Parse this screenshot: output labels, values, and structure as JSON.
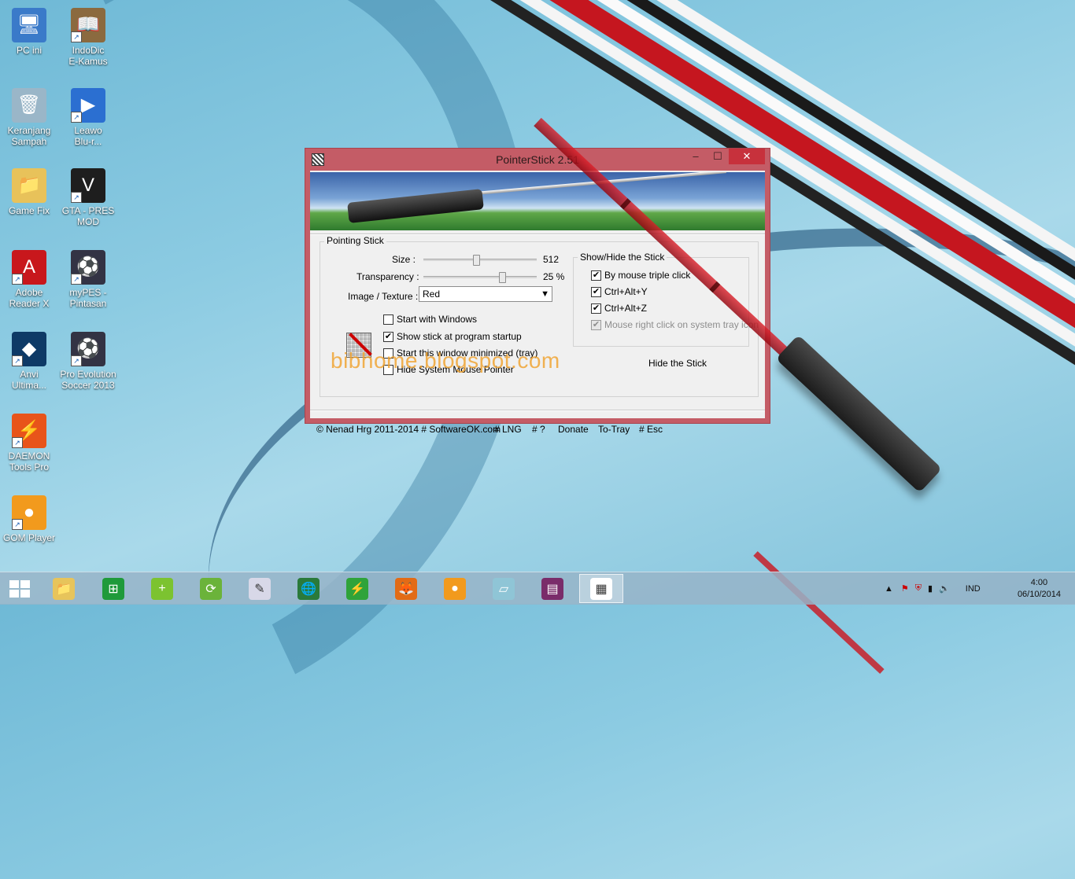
{
  "desktop": {
    "icons": [
      {
        "label": "PC ini",
        "icon": "computer-icon",
        "color": "#3a7ac9",
        "glyph": "🖥"
      },
      {
        "label": "IndoDic\nE-Kamus",
        "icon": "book-icon",
        "color": "#8b6a3f",
        "glyph": "📖"
      },
      {
        "label": "Keranjang\nSampah",
        "icon": "recycle-bin-icon",
        "color": "#9ab6c8",
        "glyph": "🗑"
      },
      {
        "label": "Leawo\nBlu-r...",
        "icon": "leawo-icon",
        "color": "#2b6fd1",
        "glyph": "▶"
      },
      {
        "label": "Game Fix",
        "icon": "folder-icon",
        "color": "#e8c25a",
        "glyph": "📁"
      },
      {
        "label": "GTA - PRES\nMOD",
        "icon": "gta-icon",
        "color": "#1e1e1e",
        "glyph": "V"
      },
      {
        "label": "Adobe\nReader X",
        "icon": "pdf-icon",
        "color": "#c8171c",
        "glyph": "A"
      },
      {
        "label": "myPES -\nPintasan",
        "icon": "pes-icon",
        "color": "#334",
        "glyph": "⚽"
      },
      {
        "label": "Anvi\nUltima...",
        "icon": "anvi-icon",
        "color": "#0e3a66",
        "glyph": "◆"
      },
      {
        "label": "Pro Evolution\nSoccer 2013",
        "icon": "pes2013-icon",
        "color": "#334",
        "glyph": "⚽"
      },
      {
        "label": "DAEMON\nTools Pro",
        "icon": "daemon-icon",
        "color": "#e8541a",
        "glyph": "⚡"
      },
      {
        "label": "GOM Player",
        "icon": "gom-icon",
        "color": "#f29a1d",
        "glyph": "●"
      }
    ]
  },
  "window": {
    "title": "PointerStick 2.51",
    "minimize": "‒",
    "maximize": "☐",
    "close": "✕",
    "pointing_group": "Pointing Stick",
    "size_label": "Size :",
    "size_value": "512",
    "size_fraction": 0.46,
    "transparency_label": "Transparency :",
    "transparency_value": "25 %",
    "transparency_fraction": 0.7,
    "image_label": "Image / Texture :",
    "image_value": "Red",
    "options": [
      {
        "label": "Start with Windows",
        "checked": false
      },
      {
        "label": "Show stick at program startup",
        "checked": true
      },
      {
        "label": "Start this window minimized (tray)",
        "checked": false
      },
      {
        "label": "Hide System Mouse Pointer",
        "checked": false
      }
    ],
    "showhide_group": "Show/Hide the Stick",
    "showhide_options": [
      {
        "label": "By mouse triple click",
        "checked": true,
        "disabled": false
      },
      {
        "label": "Ctrl+Alt+Y",
        "checked": true,
        "disabled": false
      },
      {
        "label": "Ctrl+Alt+Z",
        "checked": true,
        "disabled": false
      },
      {
        "label": "Mouse right click on system tray icon",
        "checked": true,
        "disabled": true
      }
    ],
    "hide_button": "Hide the Stick",
    "watermark": "bibhome.blogspot.com",
    "footer": {
      "copyright": "© Nenad Hrg 2011-2014 # SoftwareOK.com",
      "lng": "# LNG",
      "help": "# ?",
      "donate": "Donate",
      "totray": "To-Tray",
      "esc": "# Esc"
    }
  },
  "taskbar": {
    "items": [
      {
        "name": "file-explorer-icon",
        "color": "#e7c45b",
        "glyph": "📁"
      },
      {
        "name": "store-icon",
        "color": "#1f9a3a",
        "glyph": "⊞"
      },
      {
        "name": "plus-app-icon",
        "color": "#7cc330",
        "glyph": "+"
      },
      {
        "name": "download-app-icon",
        "color": "#6bb33a",
        "glyph": "⟳"
      },
      {
        "name": "notepad-icon",
        "color": "#d8d8e8",
        "glyph": "✎"
      },
      {
        "name": "idm-icon",
        "color": "#2a7a3a",
        "glyph": "🌐"
      },
      {
        "name": "flashget-icon",
        "color": "#2fa33a",
        "glyph": "⚡"
      },
      {
        "name": "firefox-icon",
        "color": "#e26b16",
        "glyph": "🦊"
      },
      {
        "name": "gom-taskbar-icon",
        "color": "#f29a1d",
        "glyph": "●"
      },
      {
        "name": "clipboard-icon",
        "color": "#8fc5d6",
        "glyph": "▱"
      },
      {
        "name": "winrar-icon",
        "color": "#7a2c6a",
        "glyph": "▤"
      },
      {
        "name": "pointerstick-taskbar-icon",
        "color": "#ffffff",
        "glyph": "▦"
      }
    ],
    "language": "IND",
    "time": "4:00",
    "date": "06/10/2014"
  }
}
